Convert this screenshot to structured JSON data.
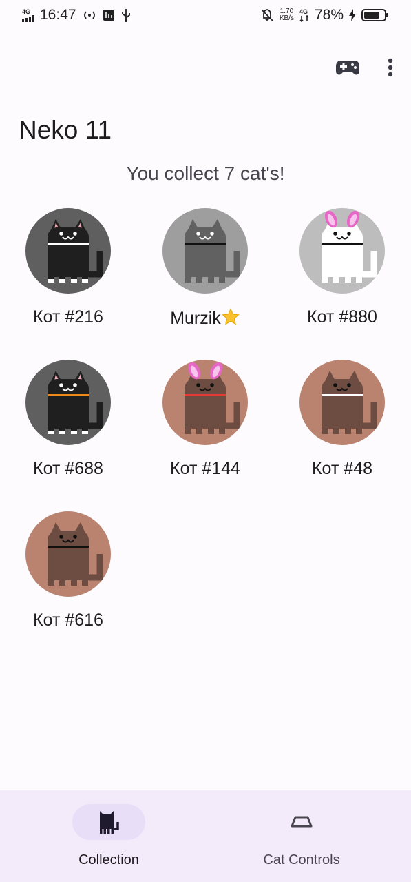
{
  "status_bar": {
    "network_left": "4G",
    "time": "16:47",
    "speed_value": "1.70",
    "speed_unit": "KB/s",
    "network_right": "4G",
    "battery_percent": "78%"
  },
  "toolbar": {
    "game_icon": "gamepad-icon",
    "menu_icon": "more-vert-icon"
  },
  "app": {
    "title": "Neko 11",
    "subtitle": "You collect 7 cat's!"
  },
  "cats": [
    {
      "name": "Кот #216",
      "bg": "#5f5f5f",
      "body": "#1f1f1f",
      "collar": "#ffffff",
      "face": "#ffffff",
      "ears": "#e8a7b3",
      "hat": false,
      "star": false
    },
    {
      "name": "Murzik",
      "bg": "#9e9e9e",
      "body": "#616161",
      "collar": "#111111",
      "face": "#ffffff",
      "ears": "#616161",
      "hat": false,
      "star": true
    },
    {
      "name": "Кот #880",
      "bg": "#bdbdbd",
      "body": "#ffffff",
      "collar": "#111111",
      "face": "#111111",
      "ears": "#ffffff",
      "hat": true,
      "star": false
    },
    {
      "name": "Кот #688",
      "bg": "#5f5f5f",
      "body": "#1f1f1f",
      "collar": "#ef8a1a",
      "face": "#ffffff",
      "ears": "#e8a7b3",
      "hat": false,
      "star": false
    },
    {
      "name": "Кот #144",
      "bg": "#b98370",
      "body": "#6d4c41",
      "collar": "#e53935",
      "face": "#111111",
      "ears": "#6d4c41",
      "hat": true,
      "star": false
    },
    {
      "name": "Кот #48",
      "bg": "#b98370",
      "body": "#6d4c41",
      "collar": "#ffffff",
      "face": "#111111",
      "ears": "#6d4c41",
      "hat": false,
      "star": false
    },
    {
      "name": "Кот #616",
      "bg": "#b98370",
      "body": "#6d4c41",
      "collar": "#111111",
      "face": "#111111",
      "ears": "#6d4c41",
      "hat": false,
      "star": false
    }
  ],
  "bottom_nav": {
    "items": [
      {
        "label": "Collection",
        "icon": "cat-icon",
        "active": true
      },
      {
        "label": "Cat Controls",
        "icon": "food-bowl-icon",
        "active": false
      }
    ]
  },
  "colors": {
    "background": "#fefbfe",
    "nav_background": "#f3eafa",
    "active_pill": "#e8def8",
    "star": "#fbc02d"
  }
}
